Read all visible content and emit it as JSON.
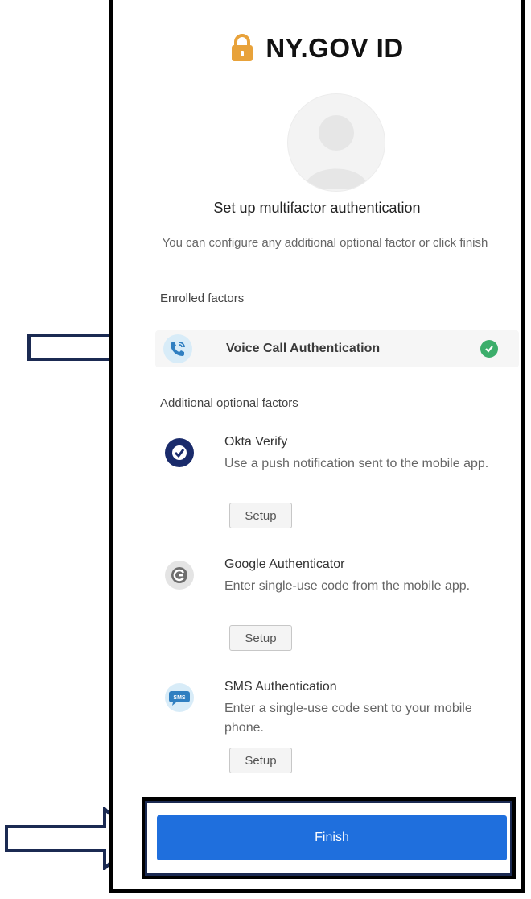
{
  "brand": {
    "title": "NY.GOV ID",
    "lock_color": "#e8a23a"
  },
  "header": {
    "title": "Set up multifactor authentication",
    "subtitle": "You can configure any additional optional factor or click finish"
  },
  "enrolled": {
    "label": "Enrolled factors",
    "factor_name": "Voice Call Authentication",
    "status_icon": "check-circle-icon",
    "status_color": "#3cae6b"
  },
  "additional": {
    "label": "Additional optional factors",
    "factors": [
      {
        "name": "Okta Verify",
        "description": "Use a push notification sent to the mobile app.",
        "icon": "okta-verify-icon",
        "setup_label": "Setup"
      },
      {
        "name": "Google Authenticator",
        "description": "Enter single-use code from the mobile app.",
        "icon": "google-authenticator-icon",
        "setup_label": "Setup"
      },
      {
        "name": "SMS Authentication",
        "description": "Enter a single-use code sent to your mobile phone.",
        "icon": "sms-icon",
        "setup_label": "Setup",
        "icon_text": "SMS"
      }
    ]
  },
  "finish": {
    "label": "Finish",
    "color": "#1f6fdd"
  },
  "annotations": {
    "arrow_color": "#1b2a52"
  }
}
